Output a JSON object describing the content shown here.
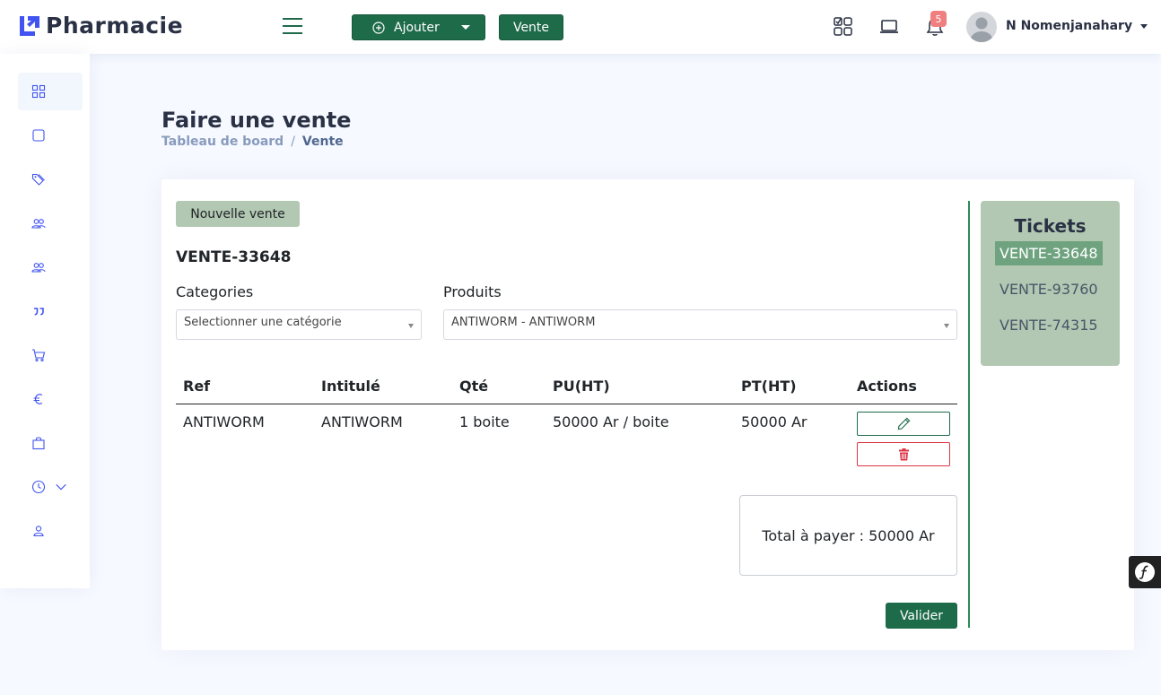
{
  "header": {
    "brand": "Pharmacie",
    "add_button": "Ajouter",
    "sale_button": "Vente",
    "notification_count": "5",
    "user_name": "N Nomenjanahary"
  },
  "page": {
    "title": "Faire une vente",
    "breadcrumb": {
      "home": "Tableau de board",
      "separator": "/",
      "current": "Vente"
    }
  },
  "sale": {
    "new_sale_button": "Nouvelle vente",
    "sale_id": "VENTE-33648",
    "categories_label": "Categories",
    "categories_value": "Selectionner une catégorie",
    "products_label": "Produits",
    "products_value": "ANTIWORM - ANTIWORM",
    "table": {
      "headers": [
        "Ref",
        "Intitulé",
        "Qté",
        "PU(HT)",
        "PT(HT)",
        "Actions"
      ],
      "rows": [
        {
          "ref": "ANTIWORM",
          "label": "ANTIWORM",
          "qty": "1 boite",
          "unit_price": "50000 Ar / boite",
          "total": "50000 Ar"
        }
      ]
    },
    "total_text": "Total à payer : 50000 Ar",
    "validate_button": "Valider"
  },
  "tickets": {
    "title": "Tickets",
    "items": [
      "VENTE-33648",
      "VENTE-93760",
      "VENTE-74315"
    ],
    "active": "VENTE-33648"
  },
  "colors": {
    "primary": "#1e6b4a",
    "ticket_panel": "#b2c8b2",
    "ticket_active": "#6fa37f",
    "danger": "#dc3545",
    "background": "#f6f9ff"
  },
  "sidebar_icons": [
    "grid-icon",
    "square-icon",
    "tags-icon",
    "people-icon",
    "people-icon",
    "quote-icon",
    "cart-icon",
    "euro-icon",
    "bag-icon",
    "clock-icon",
    "person-icon"
  ]
}
